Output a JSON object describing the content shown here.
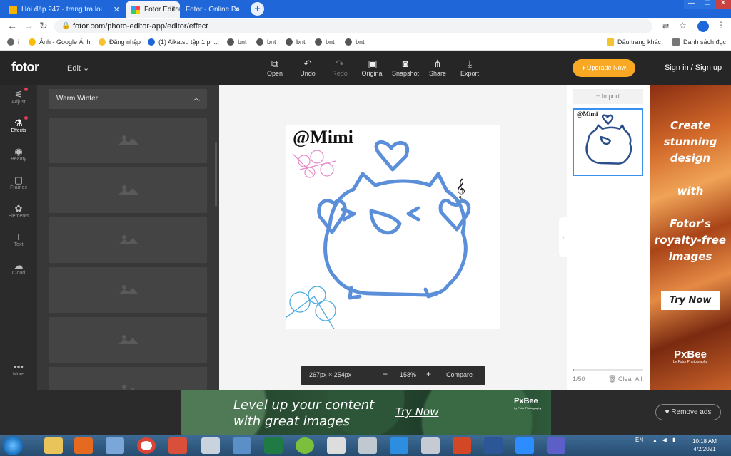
{
  "browser": {
    "tabs": [
      {
        "title": "Hỏi đáp 247 - trang tra loi",
        "active": false
      },
      {
        "title": "Fotor Editor",
        "active": true
      },
      {
        "title": "Fotor - Online Fo",
        "active": false
      }
    ],
    "new_tab": "+",
    "url": "fotor.com/photo-editor-app/editor/effect",
    "bookmarks": [
      "Ảnh - Google Ảnh",
      "Đăng nhập",
      "(1) Aikatsu tập 1 ph...",
      "bnt",
      "bnt",
      "bnt",
      "bnt",
      "bnt"
    ],
    "bookmarks_right": [
      "Dấu trang khác",
      "Danh sách đọc"
    ],
    "window_controls": [
      "—",
      "☐",
      "✕"
    ]
  },
  "fotor": {
    "logo": "fotor",
    "edit_menu": "Edit",
    "tools": [
      {
        "label": "Open",
        "icon": "open-icon",
        "glyph": "⧉",
        "enabled": true
      },
      {
        "label": "Undo",
        "icon": "undo-icon",
        "glyph": "↶",
        "enabled": true
      },
      {
        "label": "Redo",
        "icon": "redo-icon",
        "glyph": "↷",
        "enabled": false
      },
      {
        "label": "Original",
        "icon": "original-icon",
        "glyph": "▣",
        "enabled": true
      },
      {
        "label": "Snapshot",
        "icon": "snapshot-icon",
        "glyph": "◙",
        "enabled": true
      },
      {
        "label": "Share",
        "icon": "share-icon",
        "glyph": "⋔",
        "enabled": true
      },
      {
        "label": "Export",
        "icon": "export-icon",
        "glyph": "⤓",
        "enabled": true
      }
    ],
    "upgrade": "Upgrade Now",
    "signin": "Sign in / Sign up",
    "rail": [
      {
        "label": "Adjust",
        "icon": "adjust-icon",
        "glyph": "⚟",
        "dot": true
      },
      {
        "label": "Effects",
        "icon": "effects-icon",
        "glyph": "⚗",
        "dot": true,
        "active": true
      },
      {
        "label": "Beauty",
        "icon": "beauty-icon",
        "glyph": "◉"
      },
      {
        "label": "Frames",
        "icon": "frames-icon",
        "glyph": "▢"
      },
      {
        "label": "Elements",
        "icon": "elements-icon",
        "glyph": "✿"
      },
      {
        "label": "Text",
        "icon": "text-icon",
        "glyph": "T"
      },
      {
        "label": "Cloud",
        "icon": "cloud-icon",
        "glyph": "☁"
      },
      {
        "label": "More",
        "icon": "more-icon",
        "glyph": "•••"
      }
    ],
    "panel_title": "Warm Winter",
    "image_watermark": "@Mimi",
    "zoom": {
      "size": "267px × 254px",
      "minus": "−",
      "level": "158%",
      "plus": "+",
      "compare": "Compare"
    },
    "right_panel": {
      "import": "Import",
      "count": "1/50",
      "clear_all": "Clear All",
      "used_fraction": 0.02
    }
  },
  "ads": {
    "side_text": [
      "Create",
      "stunning",
      "design",
      "",
      "with",
      "",
      "Fotor's",
      "royalty-free",
      "images"
    ],
    "side_cta": "Try Now",
    "brand": "PxBee",
    "brand_sub": "by Fotor Photography",
    "bottom_text": [
      "Level up your content",
      "with great images"
    ],
    "bottom_cta": "Try Now",
    "remove_ads": "Remove ads"
  },
  "taskbar": {
    "lang": "EN",
    "time": "10:18 AM",
    "date": "4/2/2021"
  },
  "colors": {
    "accent": "#3b8ff0",
    "upgrade": "#f8a822",
    "drawing_stroke": "#5b8fd9"
  }
}
